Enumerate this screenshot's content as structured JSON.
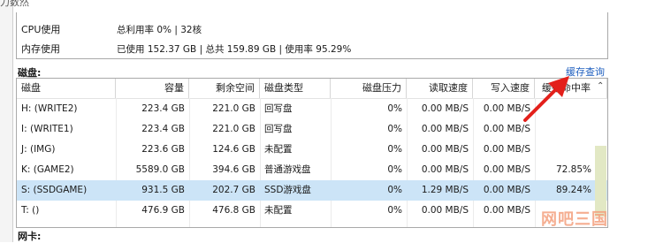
{
  "top_cut_text": "力数然",
  "info": {
    "cpu_label": "CPU使用",
    "cpu_value": "总利用率 0% | 32核",
    "mem_label": "内存使用",
    "mem_value": "已使用 152.37 GB | 总共 159.89 GB | 使用率 95.29%"
  },
  "disk_section_label": "磁盘:",
  "cache_query_link": "缓存查询",
  "table": {
    "columns": [
      "磁盘",
      "容量",
      "剩余空间",
      "磁盘类型",
      "磁盘压力",
      "读取速度",
      "写入速度",
      "缓存命中率"
    ],
    "rows": [
      {
        "disk": "H: (WRITE2)",
        "capacity": "223.4 GB",
        "free": "221.0 GB",
        "type": "回写盘",
        "pressure": "0%",
        "read": "0.00 MB/S",
        "write": "0.00 MB/S",
        "hit": ""
      },
      {
        "disk": "I: (WRITE1)",
        "capacity": "223.4 GB",
        "free": "221.0 GB",
        "type": "回写盘",
        "pressure": "0%",
        "read": "0.00 MB/S",
        "write": "0.00 MB/S",
        "hit": ""
      },
      {
        "disk": "J: (IMG)",
        "capacity": "223.6 GB",
        "free": "124.6 GB",
        "type": "未配置",
        "pressure": "0%",
        "read": "0.00 MB/S",
        "write": "0.00 MB/S",
        "hit": ""
      },
      {
        "disk": "K: (GAME2)",
        "capacity": "5589.0 GB",
        "free": "394.6 GB",
        "type": "普通游戏盘",
        "pressure": "0%",
        "read": "0.00 MB/S",
        "write": "0.00 MB/S",
        "hit": "72.85%"
      },
      {
        "disk": "S: (SSDGAME)",
        "capacity": "931.5 GB",
        "free": "202.7 GB",
        "type": "SSD游戏盘",
        "pressure": "0%",
        "read": "1.29 MB/S",
        "write": "0.00 MB/S",
        "hit": "89.24%"
      },
      {
        "disk": "T: ()",
        "capacity": "476.9 GB",
        "free": "476.8 GB",
        "type": "未配置",
        "pressure": "0%",
        "read": "0.00 MB/S",
        "write": "0.00 MB/S",
        "hit": ""
      }
    ]
  },
  "nic_section_label": "网卡:",
  "watermark": "网吧三国",
  "colors": {
    "selection": "#cce4f7",
    "link": "#1f5fbf",
    "arrow": "#e3201b"
  },
  "icons": {
    "sort": "chevron-up-icon",
    "arrow": "red-arrow-annotation"
  }
}
